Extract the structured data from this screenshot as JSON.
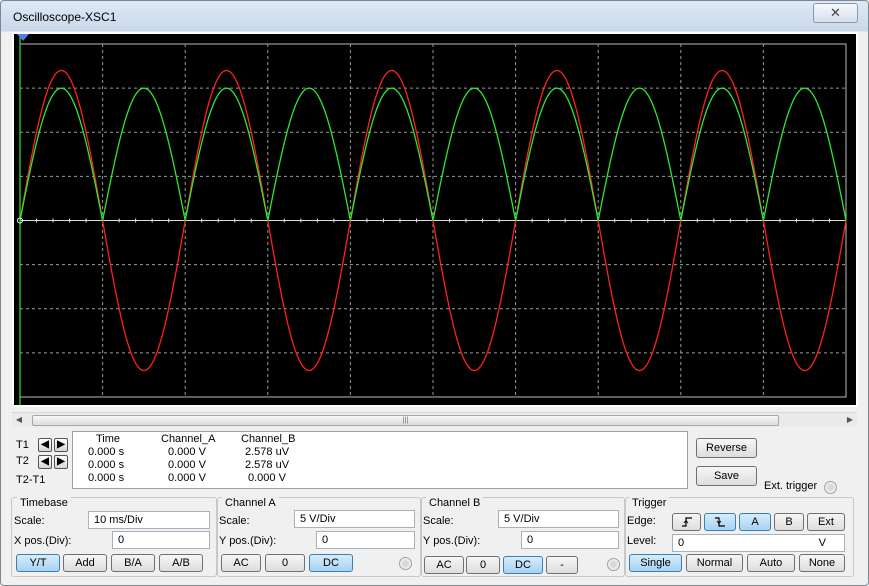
{
  "window": {
    "title": "Oscilloscope-XSC1",
    "close_glyph": "✕"
  },
  "cursors": {
    "t1_label": "T1",
    "t2_label": "T2",
    "diff_label": "T2-T1"
  },
  "readout": {
    "headers": [
      "Time",
      "Channel_A",
      "Channel_B"
    ],
    "rows": [
      [
        "0.000 s",
        "0.000 V",
        "2.578 uV"
      ],
      [
        "0.000 s",
        "0.000 V",
        "2.578 uV"
      ],
      [
        "0.000 s",
        "0.000 V",
        "0.000 V"
      ]
    ]
  },
  "buttons": {
    "reverse": "Reverse",
    "save": "Save",
    "ext_trigger": "Ext. trigger"
  },
  "timebase": {
    "title": "Timebase",
    "scale_label": "Scale:",
    "scale_value": "10 ms/Div",
    "xpos_label": "X pos.(Div):",
    "xpos_value": "0",
    "modes": [
      "Y/T",
      "Add",
      "B/A",
      "A/B"
    ],
    "active_mode": "Y/T"
  },
  "channel_a": {
    "title": "Channel A",
    "scale_label": "Scale:",
    "scale_value": "5  V/Div",
    "ypos_label": "Y pos.(Div):",
    "ypos_value": "0",
    "coupling": [
      "AC",
      "0",
      "DC"
    ],
    "active_coupling": "DC"
  },
  "channel_b": {
    "title": "Channel B",
    "scale_label": "Scale:",
    "scale_value": "5  V/Div",
    "ypos_label": "Y pos.(Div):",
    "ypos_value": "0",
    "coupling": [
      "AC",
      "0",
      "DC",
      "-"
    ],
    "active_coupling": "DC"
  },
  "trigger": {
    "title": "Trigger",
    "edge_label": "Edge:",
    "edge_buttons": [
      "A",
      "B",
      "Ext"
    ],
    "active_source": "A",
    "level_label": "Level:",
    "level_value": "0",
    "level_unit": "V",
    "types": [
      "Single",
      "Normal",
      "Auto",
      "None"
    ],
    "active_type": "Single"
  },
  "colors": {
    "channel_a": "#ff2020",
    "channel_b": "#2ee82e",
    "screen": "#000000",
    "active": "#a6d2f3"
  },
  "chart_data": {
    "type": "line",
    "x_unit": "ms",
    "xlim": [
      0,
      100
    ],
    "ylim": [
      -20,
      20
    ],
    "y_unit": "V",
    "series": [
      {
        "name": "Channel A",
        "kind": "sine",
        "amplitude": 17,
        "frequency_hz": 50,
        "phase_deg": 0
      },
      {
        "name": "Channel B",
        "kind": "full-wave-rectified",
        "amplitude": 15,
        "frequency_hz": 50,
        "phase_deg": 0
      }
    ]
  }
}
